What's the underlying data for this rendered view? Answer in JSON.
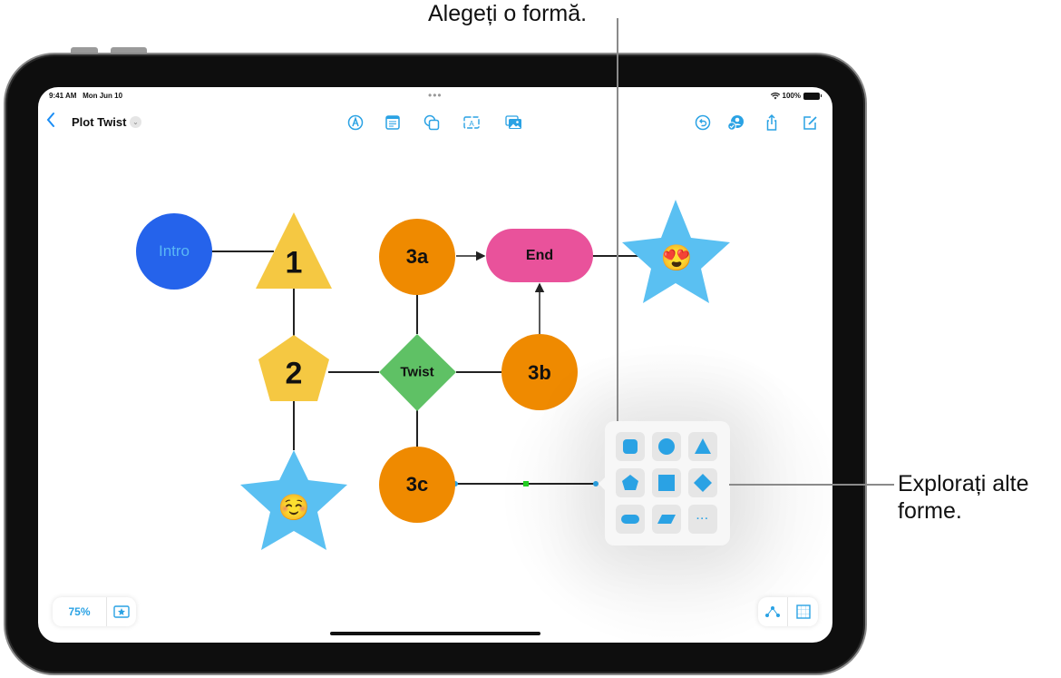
{
  "callouts": {
    "choose_shape": "Alegeți o formă.",
    "explore_shapes_line1": "Explorați alte",
    "explore_shapes_line2": "forme."
  },
  "status_bar": {
    "time": "9:41 AM",
    "date": "Mon Jun 10",
    "battery": "100%",
    "wifi_icon": "wifi-icon",
    "battery_icon": "battery-icon"
  },
  "toolbar": {
    "back_icon": "chevron-left-icon",
    "document_title": "Plot Twist",
    "title_menu_icon": "chevron-down-icon",
    "center_tools": [
      {
        "name": "pen-tool",
        "icon": "pen-icon"
      },
      {
        "name": "sticky-note",
        "icon": "sticky-note-icon"
      },
      {
        "name": "shapes",
        "icon": "shapes-icon"
      },
      {
        "name": "text-box",
        "icon": "text-box-icon"
      },
      {
        "name": "media",
        "icon": "photo-icon"
      }
    ],
    "right_tools": [
      {
        "name": "undo",
        "icon": "undo-icon"
      },
      {
        "name": "collaborate",
        "icon": "collaborate-icon"
      },
      {
        "name": "share",
        "icon": "share-icon"
      },
      {
        "name": "new-board",
        "icon": "compose-icon"
      }
    ]
  },
  "board": {
    "nodes": [
      {
        "id": "intro",
        "label": "Intro",
        "shape": "circle",
        "color": "#2563eb",
        "text_color": "#5ab8f5"
      },
      {
        "id": "n1",
        "label": "1",
        "shape": "triangle",
        "color": "#f5c842"
      },
      {
        "id": "n2",
        "label": "2",
        "shape": "pentagon",
        "color": "#f5c842"
      },
      {
        "id": "star-smile",
        "label": "☺️",
        "shape": "star",
        "color": "#5ac0f2"
      },
      {
        "id": "n3a",
        "label": "3a",
        "shape": "circle",
        "color": "#ef8a00"
      },
      {
        "id": "twist",
        "label": "Twist",
        "shape": "diamond",
        "color": "#5fc165"
      },
      {
        "id": "n3c",
        "label": "3c",
        "shape": "circle",
        "color": "#ef8a00"
      },
      {
        "id": "end",
        "label": "End",
        "shape": "rounded-rect",
        "color": "#e9529b"
      },
      {
        "id": "n3b",
        "label": "3b",
        "shape": "circle",
        "color": "#ef8a00"
      },
      {
        "id": "star-love",
        "label": "😍",
        "shape": "star",
        "color": "#5ac0f2"
      }
    ],
    "connections": [
      {
        "from": "intro",
        "to": "n1",
        "arrow": false
      },
      {
        "from": "n1",
        "to": "n2",
        "arrow": false
      },
      {
        "from": "n2",
        "to": "star-smile",
        "arrow": false
      },
      {
        "from": "n2",
        "to": "twist",
        "arrow": false
      },
      {
        "from": "twist",
        "to": "n3a",
        "arrow": false
      },
      {
        "from": "twist",
        "to": "n3b",
        "arrow": false
      },
      {
        "from": "twist",
        "to": "n3c",
        "arrow": false
      },
      {
        "from": "n3a",
        "to": "end",
        "arrow": true
      },
      {
        "from": "n3b",
        "to": "end",
        "arrow": true
      },
      {
        "from": "end",
        "to": "star-love",
        "arrow": false
      },
      {
        "from": "n3c",
        "to": "shape-picker",
        "arrow": false,
        "selected": true
      }
    ]
  },
  "shape_picker": {
    "shapes": [
      {
        "name": "rounded-square",
        "icon": "rounded-square-icon"
      },
      {
        "name": "circle",
        "icon": "circle-icon"
      },
      {
        "name": "triangle",
        "icon": "triangle-icon"
      },
      {
        "name": "pentagon",
        "icon": "pentagon-icon"
      },
      {
        "name": "square",
        "icon": "square-icon"
      },
      {
        "name": "diamond",
        "icon": "diamond-icon"
      },
      {
        "name": "pill",
        "icon": "pill-icon"
      },
      {
        "name": "parallelogram",
        "icon": "parallelogram-icon"
      },
      {
        "name": "more",
        "label": "···"
      }
    ],
    "accent": "#2aa2e4"
  },
  "bottom_bar": {
    "zoom_level": "75%",
    "zoom_percent": 75,
    "favorites_icon": "star-frame-icon",
    "connection_icon": "connection-points-icon",
    "grid_icon": "grid-icon"
  },
  "colors": {
    "accent": "#1a8df5",
    "icon_blue": "#2aa2e4"
  }
}
